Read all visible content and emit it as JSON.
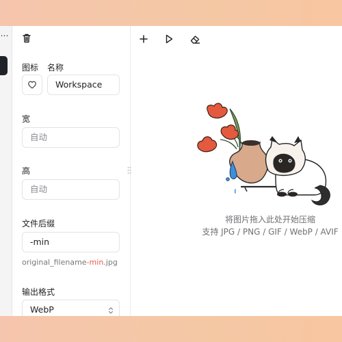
{
  "rail": {
    "menu_glyph": "⋯"
  },
  "settings": {
    "icon_label": "图标",
    "name_label": "名称",
    "name_value": "Workspace",
    "width_label": "宽",
    "width_placeholder": "自动",
    "height_label": "高",
    "height_placeholder": "自动",
    "suffix_label": "文件后缀",
    "suffix_value": "-min",
    "filename_prefix": "original_filename",
    "filename_suffix": "-min",
    "filename_ext": ".jpg",
    "format_label": "输出格式",
    "format_value": "WebP"
  },
  "toolbar": {
    "icons": [
      "plus-icon",
      "play-icon",
      "eraser-icon"
    ]
  },
  "dropzone": {
    "line1": "将图片拖入此处开始压缩",
    "line2": "支持 JPG / PNG / GIF / WebP / AVIF"
  },
  "colors": {
    "accent": "#e8584a",
    "background_gradient_left": "#f6c5ad",
    "background_gradient_right": "#f8c6a0"
  }
}
